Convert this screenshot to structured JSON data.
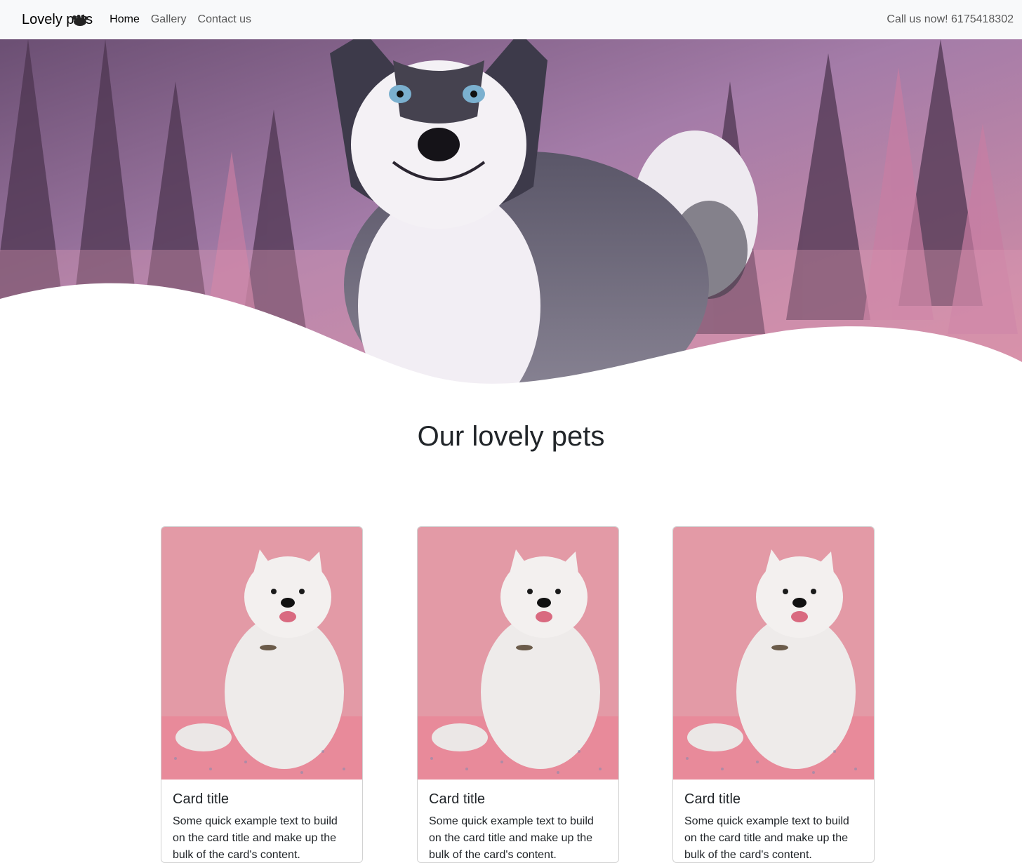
{
  "navbar": {
    "brand": "Lovely pets",
    "links": [
      {
        "label": "Home",
        "active": true
      },
      {
        "label": "Gallery",
        "active": false
      },
      {
        "label": "Contact us",
        "active": false
      }
    ],
    "phone": "Call us now! 6175418302"
  },
  "main": {
    "section_title": "Our lovely pets"
  },
  "cards": [
    {
      "title": "Card title",
      "text": "Some quick example text to build on the card title and make up the bulk of the card's content."
    },
    {
      "title": "Card title",
      "text": "Some quick example text to build on the card title and make up the bulk of the card's content."
    },
    {
      "title": "Card title",
      "text": "Some quick example text to build on the card title and make up the bulk of the card's content."
    }
  ],
  "colors": {
    "navbar_bg": "#f8f9fa",
    "hero_sky": "#8a6a95",
    "card_photo_bg": "#e39aa6"
  }
}
